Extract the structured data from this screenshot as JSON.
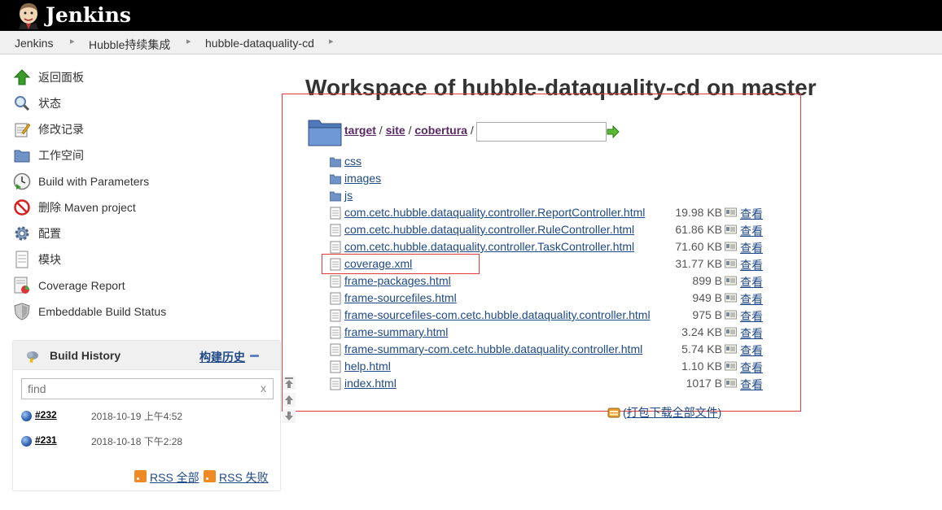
{
  "header": {
    "app_name": "Jenkins"
  },
  "breadcrumbs": [
    "Jenkins",
    "Hubble持续集成",
    "hubble-dataquality-cd"
  ],
  "sidebar": {
    "tasks": [
      {
        "label": "返回面板",
        "icon": "up-arrow-icon"
      },
      {
        "label": "状态",
        "icon": "magnifier-icon"
      },
      {
        "label": "修改记录",
        "icon": "notepad-icon"
      },
      {
        "label": "工作空间",
        "icon": "folder-icon"
      },
      {
        "label": "Build with Parameters",
        "icon": "clock-icon"
      },
      {
        "label": "删除 Maven project",
        "icon": "no-entry-icon"
      },
      {
        "label": "配置",
        "icon": "gear-icon"
      },
      {
        "label": "模块",
        "icon": "document-icon"
      },
      {
        "label": "Coverage Report",
        "icon": "report-icon"
      },
      {
        "label": "Embeddable Build Status",
        "icon": "shield-icon"
      }
    ]
  },
  "build_history": {
    "title": "Build History",
    "trend_link": "构建历史",
    "find_placeholder": "find",
    "clear_label": "x",
    "builds": [
      {
        "number": "#232",
        "date": "2018-10-19 上午4:52"
      },
      {
        "number": "#231",
        "date": "2018-10-18 下午2:28"
      }
    ],
    "rss_all": "RSS 全部",
    "rss_failed": "RSS 失败"
  },
  "main": {
    "title": "Workspace of hubble-dataquality-cd on master",
    "path": [
      "target",
      "site",
      "cobertura"
    ],
    "path_separator": "/",
    "folders": [
      "css",
      "images",
      "js"
    ],
    "files": [
      {
        "name": "com.cetc.hubble.dataquality.controller.ReportController.html",
        "size": "19.98 KB"
      },
      {
        "name": "com.cetc.hubble.dataquality.controller.RuleController.html",
        "size": "61.86 KB"
      },
      {
        "name": "com.cetc.hubble.dataquality.controller.TaskController.html",
        "size": "71.60 KB"
      },
      {
        "name": "coverage.xml",
        "size": "31.77 KB"
      },
      {
        "name": "frame-packages.html",
        "size": "899 B"
      },
      {
        "name": "frame-sourcefiles.html",
        "size": "949 B"
      },
      {
        "name": "frame-sourcefiles-com.cetc.hubble.dataquality.controller.html",
        "size": "975 B"
      },
      {
        "name": "frame-summary.html",
        "size": "3.24 KB"
      },
      {
        "name": "frame-summary-com.cetc.hubble.dataquality.controller.html",
        "size": "5.74 KB"
      },
      {
        "name": "help.html",
        "size": "1.10 KB"
      },
      {
        "name": "index.html",
        "size": "1017 B"
      }
    ],
    "view_label": "查看",
    "zip_prefix": "(",
    "zip_label": "打包下载全部文件",
    "zip_suffix": ")"
  },
  "colors": {
    "link": "#204a87",
    "highlight_border": "#e03a3a",
    "header_bg": "#000000"
  }
}
